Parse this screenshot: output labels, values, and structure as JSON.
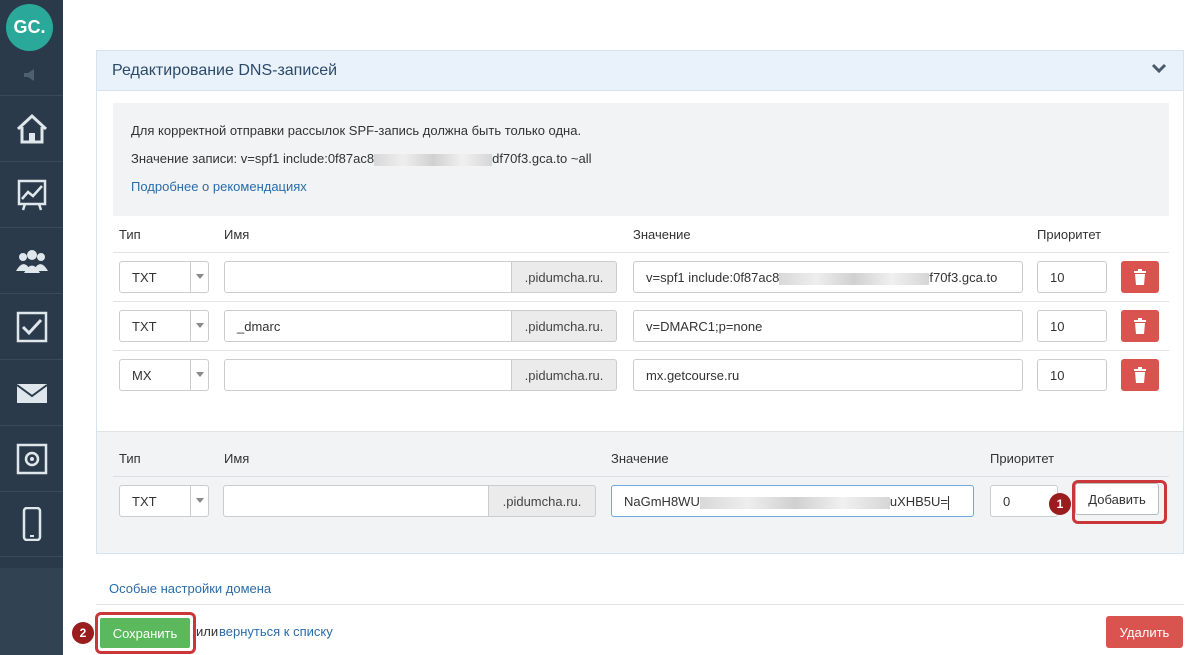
{
  "sidebar": {
    "logo": "GC.",
    "items": [
      "home-icon",
      "chart-icon",
      "users-icon",
      "tasks-icon",
      "mail-icon",
      "safe-icon",
      "mobile-icon"
    ]
  },
  "panel": {
    "title": "Редактирование DNS-записей",
    "info": {
      "line1": "Для корректной отправки рассылок SPF-запись должна быть только одна.",
      "line2_prefix": "Значение записи: v=spf1 include:0f87ac8",
      "line2_suffix": "df70f3.gca.to ~all",
      "link": "Подробнее о рекомендациях"
    },
    "columns": {
      "type": "Тип",
      "name": "Имя",
      "value": "Значение",
      "priority": "Приоритет"
    },
    "records": [
      {
        "type": "TXT",
        "name": "",
        "suffix": ".pidumcha.ru.",
        "value_prefix": "v=spf1 include:0f87ac8",
        "value_suffix": "f70f3.gca.to",
        "priority": "10"
      },
      {
        "type": "TXT",
        "name": "_dmarc",
        "suffix": ".pidumcha.ru.",
        "value": "v=DMARC1;p=none",
        "priority": "10"
      },
      {
        "type": "MX",
        "name": "",
        "suffix": ".pidumcha.ru.",
        "value": "mx.getcourse.ru",
        "priority": "10"
      }
    ],
    "new_record": {
      "type": "TXT",
      "name": "",
      "suffix": ".pidumcha.ru.",
      "value_prefix": "NaGmH8WU",
      "value_suffix": "uXHB5U=",
      "priority": "0",
      "add_label": "Добавить"
    }
  },
  "badges": {
    "add": "1",
    "save": "2"
  },
  "footer": {
    "special_link": "Особые настройки домена",
    "save_label": "Сохранить",
    "or_text": "или",
    "back_link": "вернуться к списку",
    "delete_label": "Удалить"
  },
  "colors": {
    "sidebar": "#2b3a4a",
    "accent_teal": "#2aa89a",
    "save": "#5cb85c",
    "danger": "#d9534f",
    "highlight": "#c9373b",
    "link": "#2a6ca8"
  }
}
